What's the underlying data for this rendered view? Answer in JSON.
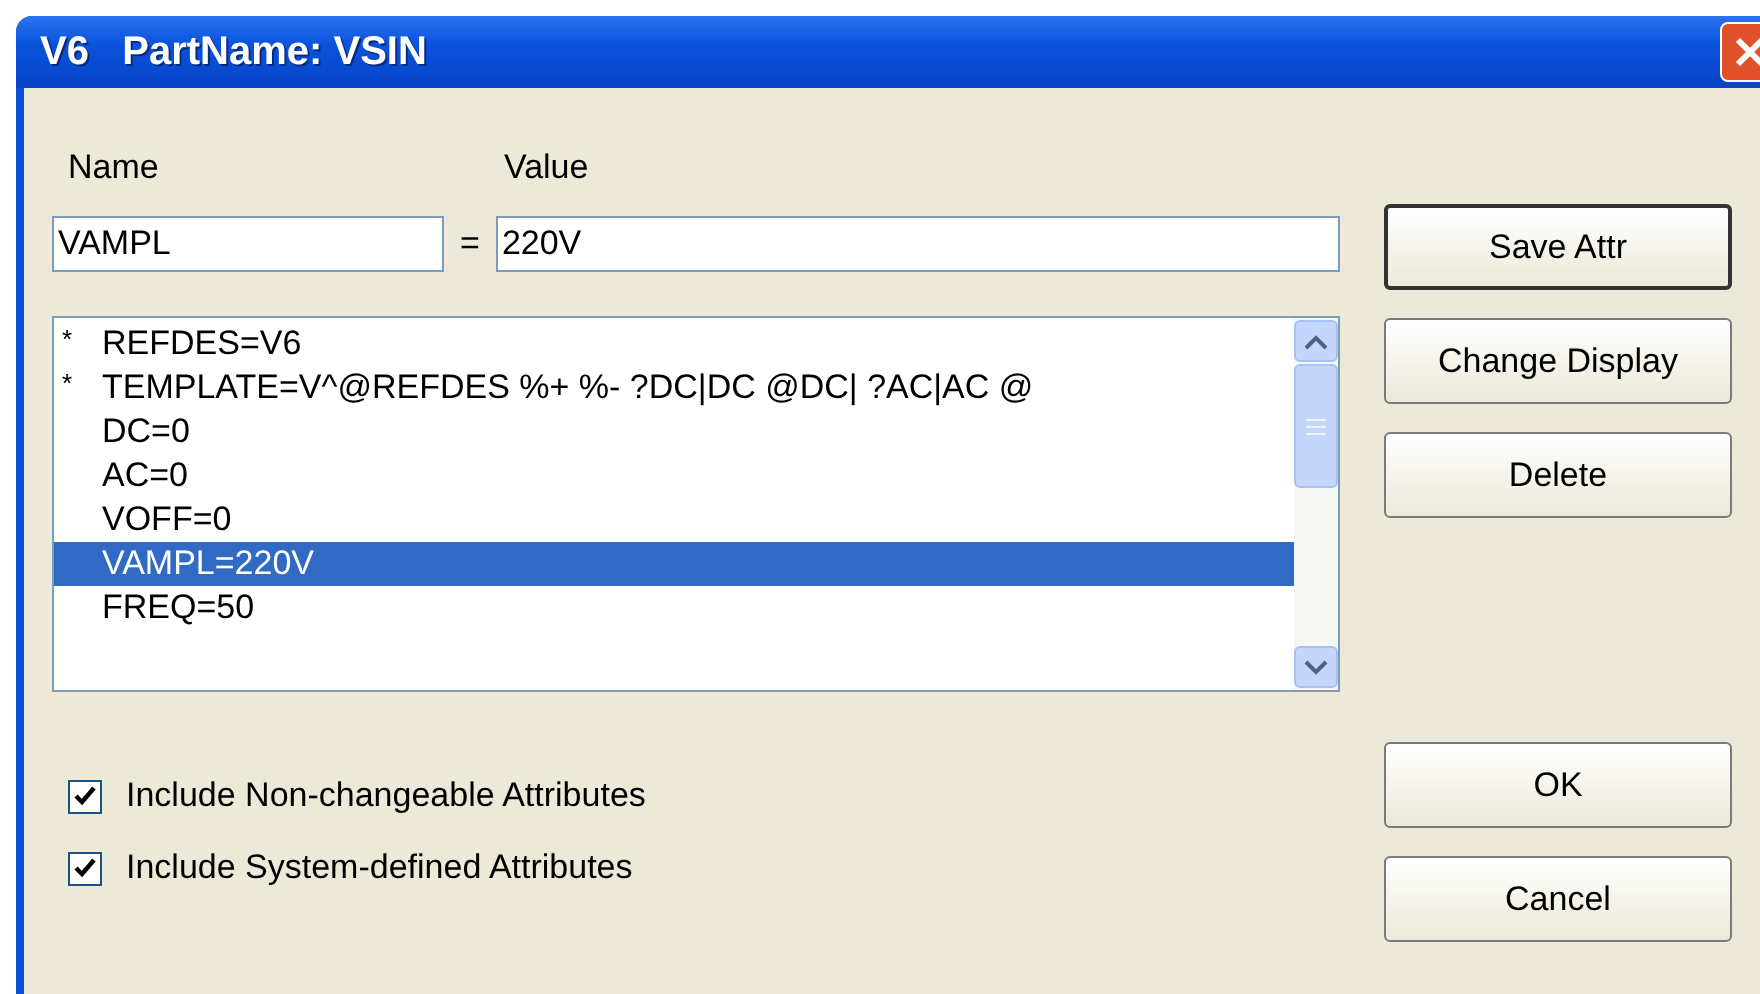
{
  "window": {
    "title": "V6   PartName: VSIN"
  },
  "name_label": {
    "text": "Name"
  },
  "value_label": {
    "text": "Value"
  },
  "name_field": {
    "value": "VAMPL"
  },
  "equals": "=",
  "value_field": {
    "value": "220V"
  },
  "attributes": [
    {
      "marker": "*",
      "text": "REFDES=V6",
      "selected": false
    },
    {
      "marker": "*",
      "text": "TEMPLATE=V^@REFDES %+ %- ?DC|DC @DC| ?AC|AC @",
      "selected": false
    },
    {
      "text": "DC=0",
      "selected": false
    },
    {
      "text": "AC=0",
      "selected": false
    },
    {
      "text": "VOFF=0",
      "selected": false
    },
    {
      "text": "VAMPL=220V",
      "selected": true
    },
    {
      "text": "FREQ=50",
      "selected": false
    }
  ],
  "side_buttons": [
    {
      "label": "Save Attr",
      "default": true
    },
    {
      "label": "Change Display",
      "default": false
    },
    {
      "label": "Delete",
      "default": false
    }
  ],
  "options": [
    {
      "label": "Include Non-changeable Attributes",
      "checked": true
    },
    {
      "label": "Include System-defined Attributes",
      "checked": true
    }
  ],
  "dialog_buttons": [
    {
      "label": "OK",
      "default": false
    },
    {
      "label": "Cancel",
      "default": false
    }
  ]
}
